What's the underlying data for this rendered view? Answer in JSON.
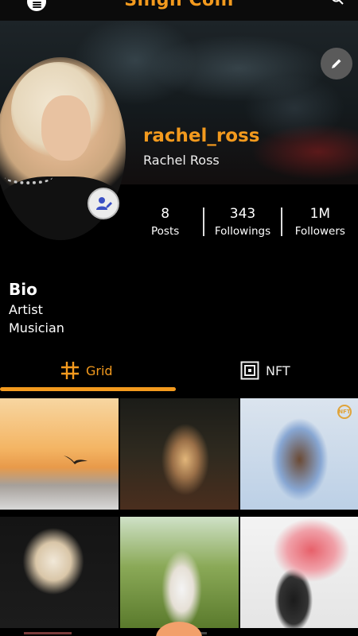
{
  "app": {
    "title": "Singh Coin"
  },
  "profile": {
    "username": "rachel_ross",
    "full_name": "Rachel Ross"
  },
  "stats": [
    {
      "value": "8",
      "label": "Posts"
    },
    {
      "value": "343",
      "label": "Followings"
    },
    {
      "value": "1M",
      "label": "Followers"
    }
  ],
  "bio": {
    "title": "Bio",
    "lines": [
      "Artist",
      "Musician"
    ]
  },
  "tabs": [
    {
      "label": "Grid",
      "icon": "grid-hash-icon",
      "active": true
    },
    {
      "label": "NFT",
      "icon": "nft-frame-icon",
      "active": false
    }
  ],
  "grid_posts": [
    {
      "subject": "sunset-bird",
      "nft": false
    },
    {
      "subject": "forest-path",
      "nft": false
    },
    {
      "subject": "woman-denim",
      "nft": true
    },
    {
      "subject": "woman-blonde",
      "nft": false
    },
    {
      "subject": "woman-field",
      "nft": false
    },
    {
      "subject": "smoke-flare",
      "nft": false
    }
  ],
  "nft_badge_text": "NFT",
  "colors": {
    "accent": "#f39a1e",
    "background": "#000000"
  }
}
